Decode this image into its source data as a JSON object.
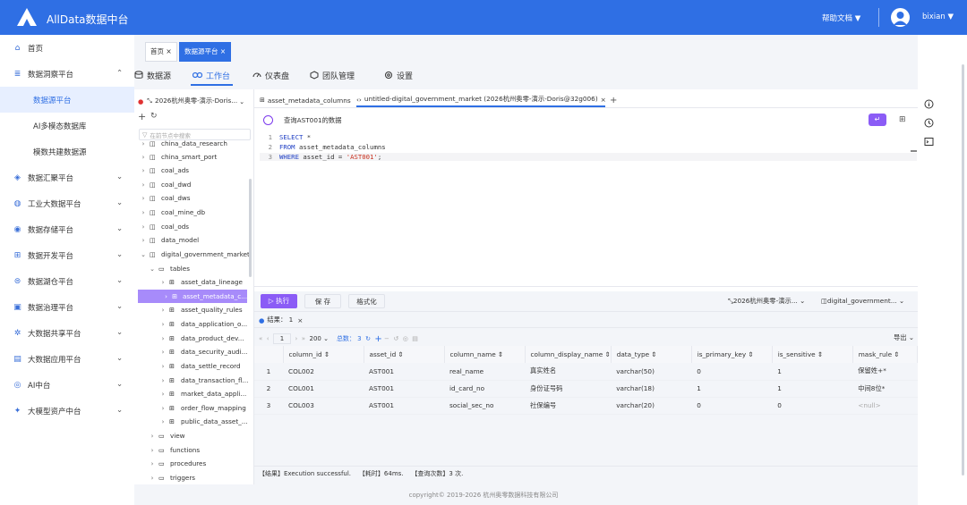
{
  "app": {
    "title": "AllData数据中台",
    "help_label": "帮助文档",
    "username": "bixian",
    "footer": "copyright© 2019-2026 杭州奥零数据科技有限公司"
  },
  "sidebar": {
    "items": [
      {
        "label": "首页",
        "icon": "home-icon"
      },
      {
        "label": "数据洞察平台",
        "icon": "database-icon"
      },
      {
        "label": "数据源平台"
      },
      {
        "label": "AI多模态数据库"
      },
      {
        "label": "模数共建数据源"
      },
      {
        "label": "数据汇聚平台",
        "icon": "stack-icon"
      },
      {
        "label": "工业大数据平台",
        "icon": "globe-icon"
      },
      {
        "label": "数据存储平台",
        "icon": "storage-icon"
      },
      {
        "label": "数据开发平台",
        "icon": "grid-icon"
      },
      {
        "label": "数据湖仓平台",
        "icon": "lake-icon"
      },
      {
        "label": "数据治理平台",
        "icon": "governance-icon"
      },
      {
        "label": "大数据共享平台",
        "icon": "share-icon"
      },
      {
        "label": "大数据应用平台",
        "icon": "app-icon"
      },
      {
        "label": "AI中台",
        "icon": "ai-icon"
      },
      {
        "label": "大模型资产中台",
        "icon": "model-icon"
      }
    ]
  },
  "page_tabs": [
    {
      "label": "首页",
      "close": "×"
    },
    {
      "label": "数据源平台",
      "close": "×"
    }
  ],
  "module_tabs": [
    {
      "label": "数据源"
    },
    {
      "label": "工作台"
    },
    {
      "label": "仪表盘"
    },
    {
      "label": "团队管理"
    },
    {
      "label": "设置"
    }
  ],
  "tree": {
    "connection": "2026杭州奥零-演示-Doris...",
    "search_placeholder": "在前节点中搜索",
    "items": [
      {
        "label": "china_data_research"
      },
      {
        "label": "china_smart_port"
      },
      {
        "label": "coal_ads"
      },
      {
        "label": "coal_dwd"
      },
      {
        "label": "coal_dws"
      },
      {
        "label": "coal_mine_db"
      },
      {
        "label": "coal_ods"
      },
      {
        "label": "data_model"
      },
      {
        "label": "digital_government_market"
      },
      {
        "label": "tables"
      },
      {
        "label": "asset_data_lineage"
      },
      {
        "label": "asset_metadata_c..."
      },
      {
        "label": "asset_quality_rules"
      },
      {
        "label": "data_application_o..."
      },
      {
        "label": "data_product_dev..."
      },
      {
        "label": "data_security_audi..."
      },
      {
        "label": "data_settle_record"
      },
      {
        "label": "data_transaction_fl..."
      },
      {
        "label": "market_data_appli..."
      },
      {
        "label": "order_flow_mapping"
      },
      {
        "label": "public_data_asset_..."
      },
      {
        "label": "view"
      },
      {
        "label": "functions"
      },
      {
        "label": "procedures"
      },
      {
        "label": "triggers"
      }
    ]
  },
  "editor": {
    "tabs": [
      {
        "label": "asset_metadata_columns"
      },
      {
        "label": "untitled-digital_government_market (2026杭州奥零-演示-Doris@32g006)"
      }
    ],
    "query_title": "查询AST001的数据",
    "lines": [
      {
        "num": "1",
        "kw1": "SELECT",
        "rest": " *"
      },
      {
        "num": "2",
        "kw1": "FROM",
        "rest": " asset_metadata_columns"
      },
      {
        "num": "3",
        "kw1": "WHERE",
        "rest": " asset_id = ",
        "str": "'AST001'",
        "tail": ";"
      }
    ],
    "run_label": "执行",
    "save_label": "保 存",
    "format_label": "格式化",
    "conn_select": "2026杭州奥零-演示...",
    "db_select": "digital_government..."
  },
  "results": {
    "tab_label": "结果： 1",
    "page": "1",
    "page_size": "200",
    "total": "总数： 3",
    "export_label": "导出",
    "columns": [
      "column_id",
      "asset_id",
      "column_name",
      "column_display_name",
      "data_type",
      "is_primary_key",
      "is_sensitive",
      "mask_rule"
    ],
    "rows": [
      [
        "1",
        "COL002",
        "AST001",
        "real_name",
        "真实姓名",
        "varchar(50)",
        "0",
        "1",
        "保留姓+*"
      ],
      [
        "2",
        "COL001",
        "AST001",
        "id_card_no",
        "身份证号码",
        "varchar(18)",
        "1",
        "1",
        "中间8位*"
      ],
      [
        "3",
        "COL003",
        "AST001",
        "social_sec_no",
        "社保编号",
        "varchar(20)",
        "0",
        "0",
        "<null>"
      ]
    ],
    "status": "【结果】Execution successful.    【耗时】64ms.    【查询次数】3 次."
  },
  "colors": {
    "brand": "#2f6fe4",
    "accent": "#8b5cf6"
  }
}
